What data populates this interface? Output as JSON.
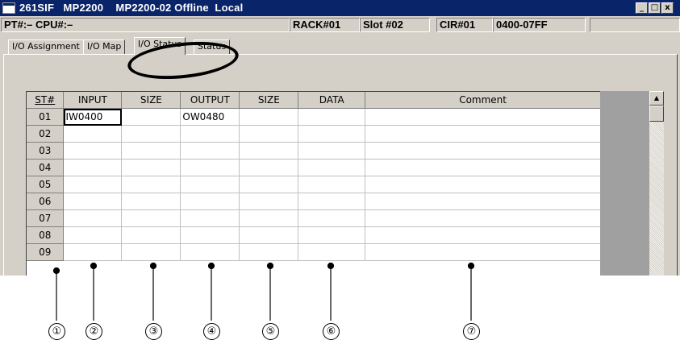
{
  "window": {
    "title": "261SIF   MP2200    MP2200-02 Offline  Local",
    "controls": {
      "minimize": "_",
      "maximize": "□",
      "close": "x"
    }
  },
  "infobar": {
    "pt_cpu": "PT#:– CPU#:–",
    "rack": "RACK#01",
    "slot": "Slot #02",
    "cir": "CIR#01",
    "range": "0400-07FF"
  },
  "tabs": [
    {
      "label": "I/O Assignment",
      "active": false
    },
    {
      "label": "I/O Map",
      "active": false
    },
    {
      "label": "I/O Status",
      "active": true
    },
    {
      "label": "Status",
      "active": false
    }
  ],
  "table": {
    "columns": [
      "ST#",
      "INPUT",
      "SIZE",
      "OUTPUT",
      "SIZE",
      "DATA",
      "Comment"
    ],
    "rows": [
      [
        "01",
        "IW0400",
        "",
        "OW0480",
        "",
        "",
        ""
      ],
      [
        "02",
        "",
        "",
        "",
        "",
        "",
        ""
      ],
      [
        "03",
        "",
        "",
        "",
        "",
        "",
        ""
      ],
      [
        "04",
        "",
        "",
        "",
        "",
        "",
        ""
      ],
      [
        "05",
        "",
        "",
        "",
        "",
        "",
        ""
      ],
      [
        "06",
        "",
        "",
        "",
        "",
        "",
        ""
      ],
      [
        "07",
        "",
        "",
        "",
        "",
        "",
        ""
      ],
      [
        "08",
        "",
        "",
        "",
        "",
        "",
        ""
      ],
      [
        "09",
        "",
        "",
        "",
        "",
        "",
        ""
      ]
    ]
  },
  "callouts": [
    "①",
    "②",
    "③",
    "④",
    "⑤",
    "⑥",
    "⑦"
  ]
}
